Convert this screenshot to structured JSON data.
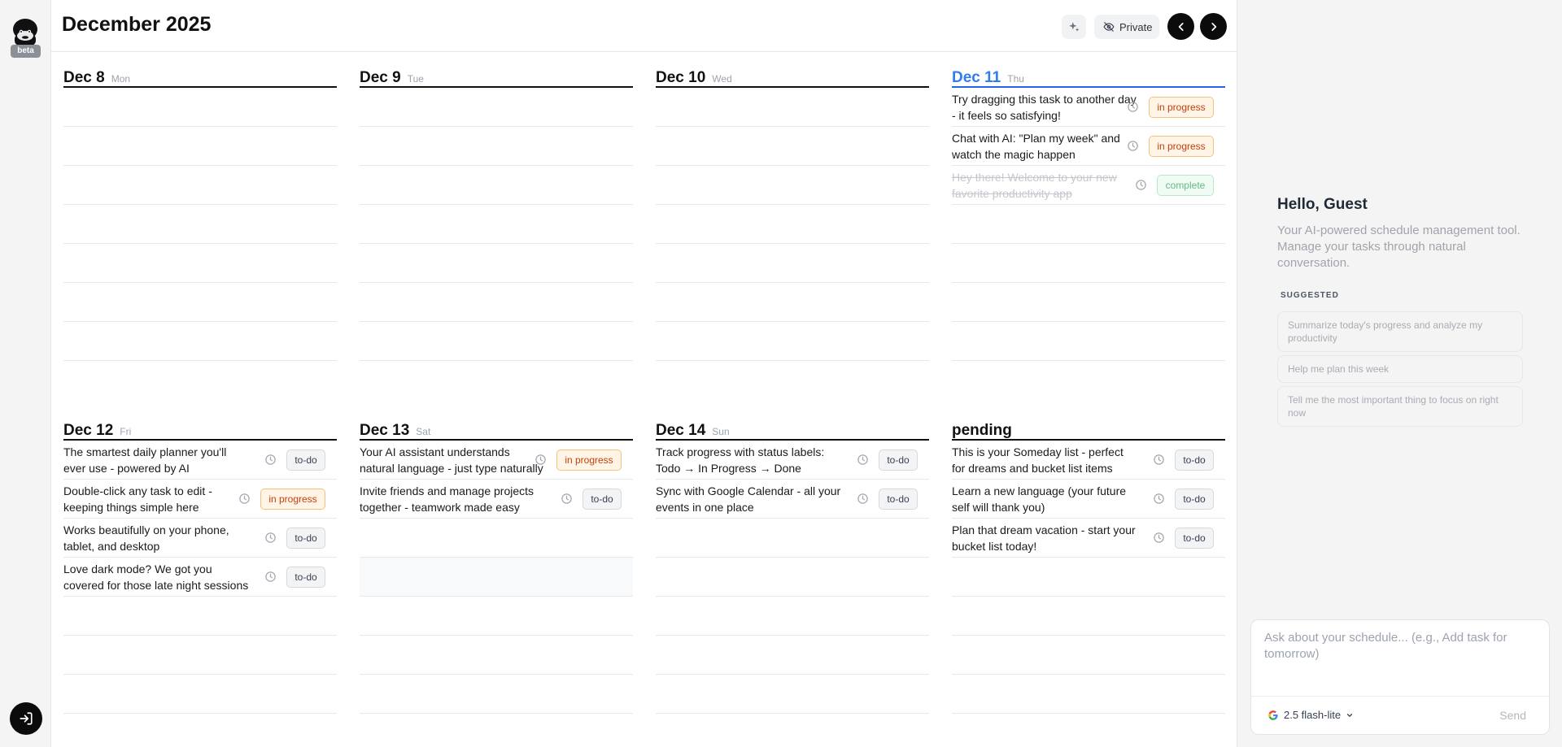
{
  "app": {
    "beta_label": "beta"
  },
  "header": {
    "title": "December 2025",
    "private_label": "Private"
  },
  "days": [
    {
      "date": "Dec 8",
      "weekday": "Mon",
      "tasks": []
    },
    {
      "date": "Dec 9",
      "weekday": "Tue",
      "tasks": []
    },
    {
      "date": "Dec 10",
      "weekday": "Wed",
      "tasks": []
    },
    {
      "date": "Dec 11",
      "weekday": "Thu",
      "today": true,
      "tasks": [
        {
          "text": "Try dragging this task to another day - it feels so satisfying!",
          "status": "in progress"
        },
        {
          "text": "Chat with AI: \"Plan my week\" and watch the magic happen",
          "status": "in progress"
        },
        {
          "text": "Hey there! Welcome to your new favorite productivity app",
          "status": "complete"
        }
      ]
    },
    {
      "date": "Dec 12",
      "weekday": "Fri",
      "tasks": [
        {
          "text": "The smartest daily planner you'll ever use - powered by AI",
          "status": "to-do"
        },
        {
          "text": "Double-click any task to edit - keeping things simple here",
          "status": "in progress"
        },
        {
          "text": "Works beautifully on your phone, tablet, and desktop",
          "status": "to-do"
        },
        {
          "text": "Love dark mode? We got you covered for those late night sessions",
          "status": "to-do"
        }
      ]
    },
    {
      "date": "Dec 13",
      "weekday": "Sat",
      "tasks": [
        {
          "text": "Your AI assistant understands natural language - just type naturally",
          "status": "in progress"
        },
        {
          "text": "Invite friends and manage projects together - teamwork made easy",
          "status": "to-do"
        }
      ]
    },
    {
      "date": "Dec 14",
      "weekday": "Sun",
      "tasks": [
        {
          "text": "Track progress with status labels: Todo → In Progress → Done",
          "status": "to-do"
        },
        {
          "text": "Sync with Google Calendar - all your events in one place",
          "status": "to-do"
        }
      ]
    },
    {
      "date": "pending",
      "weekday": "",
      "tasks": [
        {
          "text": "This is your Someday list - perfect for dreams and bucket list items",
          "status": "to-do"
        },
        {
          "text": "Learn a new language (your future self will thank you)",
          "status": "to-do"
        },
        {
          "text": "Plan that dream vacation - start your bucket list today!",
          "status": "to-do"
        }
      ]
    }
  ],
  "chat": {
    "greeting": "Hello, Guest",
    "intro": "Your AI-powered schedule management tool. Manage your tasks through natural conversation.",
    "suggested_label": "SUGGESTED",
    "suggestions": [
      "Summarize today's progress and analyze my productivity",
      "Help me plan this week",
      "Tell me the most important thing to focus on right now"
    ],
    "input_placeholder": "Ask about your schedule... (e.g., Add task for tomorrow)",
    "model": "2.5 flash-lite",
    "send_label": "Send"
  },
  "colors": {
    "accent": "#2f7cf0",
    "progress": "#c2410c",
    "complete": "#66b987"
  }
}
